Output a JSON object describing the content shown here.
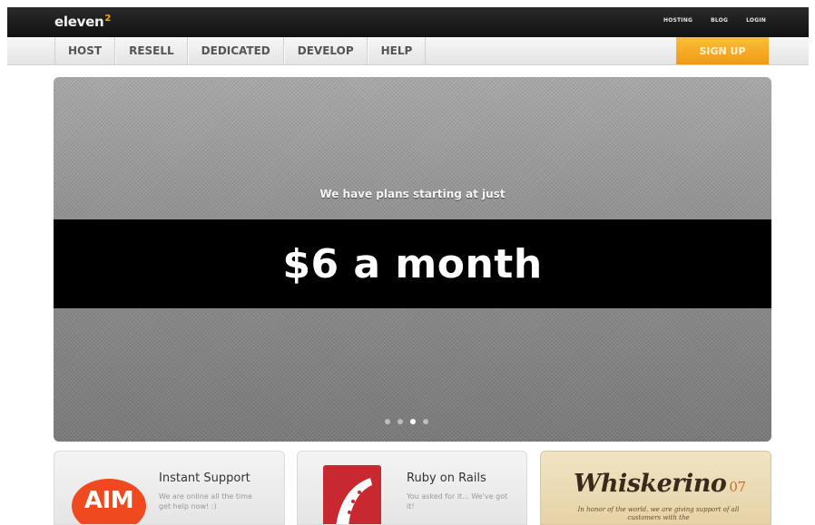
{
  "header": {
    "logo_text": "eleven",
    "logo_mark": "2",
    "links": [
      "HOSTING",
      "BLOG",
      "LOGIN"
    ]
  },
  "nav": {
    "items": [
      "HOST",
      "RESELL",
      "DEDICATED",
      "DEVELOP",
      "HELP"
    ],
    "signup_label": "SIGN UP"
  },
  "hero": {
    "tagline": "We have plans starting at just",
    "price": "$6 a month",
    "slides_total": 4,
    "active_slide": 3
  },
  "cards": [
    {
      "icon": "aim-icon",
      "icon_text": "AIM",
      "title": "Instant Support",
      "text": "We are online all the time get help now! :)"
    },
    {
      "icon": "rails-icon",
      "title": "Ruby on Rails",
      "text": "You asked for it... We've got it!"
    },
    {
      "icon": "whiskerino-logo",
      "title": "Whiskerino",
      "number": "07",
      "text": "In honor of the world, we are giving support of all customers with the"
    }
  ],
  "colors": {
    "accent": "#f5a623",
    "topbar": "#1a1a1a",
    "aim_orange": "#ef4a1f",
    "rails_red": "#c8282f"
  }
}
